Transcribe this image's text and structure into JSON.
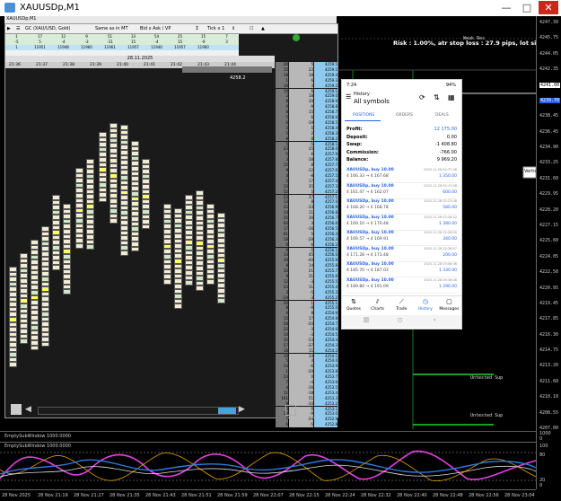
{
  "window": {
    "title": "XAUUSDp,M1",
    "minimize": "—",
    "maximize": "□",
    "close": "✕"
  },
  "sub_title": "XAUUSDp,M1",
  "toolbar": {
    "symbol": "GC (XAU/USD, Gold)",
    "mode1": "Same as in MT",
    "mode2": "Bid x Ask / VP",
    "tick": "Tick x 1",
    "icons": [
      "▶",
      "☰",
      "Σ",
      "◈",
      "⇕",
      "☐",
      "▲"
    ]
  },
  "summary": {
    "rows": [
      [
        "1",
        "17",
        "12",
        "9",
        "51",
        "33",
        "54",
        "25",
        "15",
        "7"
      ],
      [
        "-5",
        "5",
        "-4",
        "-3",
        "-31",
        "15",
        "-4",
        "15",
        "-9",
        "3"
      ],
      [
        "1",
        "11951",
        "11948",
        "11960",
        "11961",
        "11957",
        "11940",
        "11957",
        "11960",
        ""
      ],
      [
        "",
        "",
        "",
        "",
        "",
        "",
        "",
        "",
        "",
        ""
      ]
    ],
    "date": "28.11.2025",
    "times": [
      "21:36",
      "21:37",
      "21:38",
      "21:39",
      "21:40",
      "21:41",
      "21:42",
      "21:43",
      "21:44"
    ]
  },
  "ladder": [
    [
      "20",
      "5",
      "4259.5"
    ],
    [
      "15",
      "22",
      "4259.5"
    ],
    [
      "18",
      "18",
      "4259.4"
    ],
    [
      "1",
      "6",
      "4259.3"
    ],
    [
      "10",
      "3",
      "4259.2"
    ],
    [
      "19",
      "6",
      "4259.1"
    ],
    [
      "2",
      "18",
      "4259.0"
    ],
    [
      "8",
      "30",
      "4258.9"
    ],
    [
      "0",
      "-9",
      "4258.8"
    ],
    [
      "8",
      "15",
      "4258.7"
    ],
    [
      "5",
      "6",
      "4258.6"
    ],
    [
      "6",
      "-19",
      "4258.5"
    ],
    [
      "3",
      "5",
      "4258.4"
    ],
    [
      "5",
      "2",
      "4258.3"
    ],
    [
      "8",
      "8",
      "4258.2"
    ],
    [
      "5",
      "-5",
      "4258.1"
    ],
    [
      "23",
      "35",
      "4258.0"
    ],
    [
      "5",
      "6",
      "4257.9"
    ],
    [
      "3",
      "-18",
      "4257.8"
    ],
    [
      "15",
      "8",
      "4257.7"
    ],
    [
      "9",
      "-12",
      "4257.6"
    ],
    [
      "4",
      "-8",
      "4257.5"
    ],
    [
      "2",
      "17",
      "4257.4"
    ],
    [
      "33",
      "35",
      "4257.3"
    ],
    [
      "52",
      "5",
      "4257.2"
    ],
    [
      "23",
      "37",
      "4257.1"
    ],
    [
      "13",
      "8",
      "4257.0"
    ],
    [
      "22",
      "-33",
      "4256.9"
    ],
    [
      "14",
      "11",
      "4256.8"
    ],
    [
      "35",
      "36",
      "4256.7"
    ],
    [
      "60",
      "3",
      "4256.6"
    ],
    [
      "17",
      "-16",
      "4256.5"
    ],
    [
      "61",
      "5",
      "4256.4"
    ],
    [
      "16",
      "-28",
      "4256.3"
    ],
    [
      "0",
      "6",
      "4256.2"
    ],
    [
      "6",
      "-5",
      "4256.1"
    ],
    [
      "14",
      "45",
      "4256.0"
    ],
    [
      "30",
      "-40",
      "4255.9"
    ],
    [
      "8",
      "14",
      "4255.8"
    ],
    [
      "35",
      "21",
      "4255.7"
    ],
    [
      "9",
      "31",
      "4255.6"
    ],
    [
      "12",
      "-3",
      "4255.5"
    ],
    [
      "23",
      "11",
      "4255.4"
    ],
    [
      "3",
      "-5",
      "4255.3"
    ],
    [
      "-24",
      "-3",
      "4255.2"
    ],
    [
      "20",
      "1",
      "4255.1"
    ],
    [
      "8",
      "-9",
      "4255.0"
    ],
    [
      "0",
      "8",
      "4254.9"
    ],
    [
      "15",
      "17",
      "4254.8"
    ],
    [
      "58",
      "-20",
      "4254.7"
    ],
    [
      "22",
      "-3",
      "4254.6"
    ],
    [
      "10",
      "-3",
      "4254.5"
    ],
    [
      "35",
      "-33",
      "4254.4"
    ],
    [
      "57",
      "-37",
      "4254.3"
    ],
    [
      "16",
      "11",
      "4254.2"
    ],
    [
      "10",
      "14",
      "4254.1"
    ],
    [
      "5",
      "4",
      "4254.0"
    ],
    [
      "14",
      "-6",
      "4253.9"
    ],
    [
      "1",
      "-20",
      "4253.8"
    ],
    [
      "23",
      "0",
      "4253.7"
    ],
    [
      "7",
      "-4",
      "4253.6"
    ],
    [
      "4",
      "-16",
      "4253.5"
    ],
    [
      "11",
      "-18",
      "4253.4"
    ],
    [
      "161",
      "51",
      "4253.3"
    ],
    [
      "9",
      "-10",
      "4253.2"
    ],
    [
      "5",
      "0",
      "4253.1"
    ],
    [
      "20",
      "-9",
      "4253.0"
    ],
    [
      "7",
      "-24",
      "4252.9"
    ],
    [
      "6",
      "-5",
      "4252.8"
    ]
  ],
  "price_line_label": "4258.2",
  "info": {
    "risk": "Risk : 1.00%, atr stop loss : 27.9 pips, lot size : 7.02",
    "zone_top": "Weak Res",
    "zone_bottom1": "Untested Sup",
    "zone_bottom2": "Untested Sup",
    "vertical_label": "Vertica"
  },
  "price_axis": [
    "4247.39",
    "4245.75",
    "4244.05",
    "4242.35",
    "4241.00",
    "4239.70",
    "4238.45",
    "4236.45",
    "4234.90",
    "4233.25",
    "4231.60",
    "4229.95",
    "4228.20",
    "4227.15",
    "4225.60",
    "4224.05",
    "4222.50",
    "4220.95",
    "4219.45",
    "4217.85",
    "4216.30",
    "4214.75",
    "4213.20",
    "4211.60",
    "4210.10",
    "4208.55",
    "4207.00"
  ],
  "price_axis_tags": {
    "white": "4241.00",
    "blue": "4239.70"
  },
  "osc": {
    "title1": "EmptySubWindow 1000.0000",
    "title2": "EmptySubWindow 1000.0000",
    "scale": [
      "1000",
      "0",
      "100",
      "80",
      "20",
      "0"
    ]
  },
  "time_axis": [
    "28 Nov 2025",
    "28 Nov 21:19",
    "28 Nov 21:27",
    "28 Nov 21:35",
    "28 Nov 21:43",
    "28 Nov 21:51",
    "28 Nov 21:59",
    "28 Nov 22:07",
    "28 Nov 22:15",
    "28 Nov 22:24",
    "28 Nov 22:32",
    "28 Nov 22:40",
    "28 Nov 22:48",
    "28 Nov 22:56",
    "28 Nov 23:04"
  ],
  "phone": {
    "status_time": "7:24",
    "status_right": "94%",
    "header": "History",
    "subheader": "All symbols",
    "tabs": [
      "POSITIONS",
      "ORDERS",
      "DEALS"
    ],
    "balances": [
      {
        "k": "Profit:",
        "v": "12 175.00"
      },
      {
        "k": "Deposit:",
        "v": "0.00"
      },
      {
        "k": "Swap:",
        "v": "-1 408.80"
      },
      {
        "k": "Commission:",
        "v": "-766.00"
      },
      {
        "k": "Balance:",
        "v": "9 969.20"
      }
    ],
    "trades": [
      {
        "sym": "XAUUSDp, buy 10.00",
        "px": "4 166.33 → 4 167.68",
        "time": "2025.11.28 02:37:36",
        "pl": "1 350.00"
      },
      {
        "sym": "XAUUSDp, buy 10.00",
        "px": "4 161.47 → 4 162.07",
        "time": "2025.11.28 02:13:08",
        "pl": "600.00"
      },
      {
        "sym": "XAUUSDp, buy 10.00",
        "px": "4 168.20 → 4 168.78",
        "time": "2025.11.28 02:23:08",
        "pl": "580.00"
      },
      {
        "sym": "XAUUSDp, buy 10.00",
        "px": "4 169.10 → 4 170.48",
        "time": "2025.11.28 02:26:22",
        "pl": "1 380.00"
      },
      {
        "sym": "XAUUSDp, buy 10.00",
        "px": "4 169.57 → 4 169.91",
        "time": "2025.11.28 02:28:50",
        "pl": "340.00"
      },
      {
        "sym": "XAUUSDp, buy 10.00",
        "px": "4 171.28 → 4 171.48",
        "time": "2025.11.28 02:28:57",
        "pl": "200.00"
      },
      {
        "sym": "XAUUSDp, buy 10.00",
        "px": "4 185.70 → 4 187.03",
        "time": "2025.11.28 03:56:36",
        "pl": "1 330.00"
      },
      {
        "sym": "XAUUSDp, buy 10.00",
        "px": "4 189.80 → 4 191.09",
        "time": "2025.11.28 05:36:46",
        "pl": "1 290.00"
      }
    ],
    "nav": [
      "Quotes",
      "Charts",
      "Trade",
      "History",
      "Messages"
    ],
    "sys": [
      "|||",
      "○",
      "‹"
    ]
  }
}
